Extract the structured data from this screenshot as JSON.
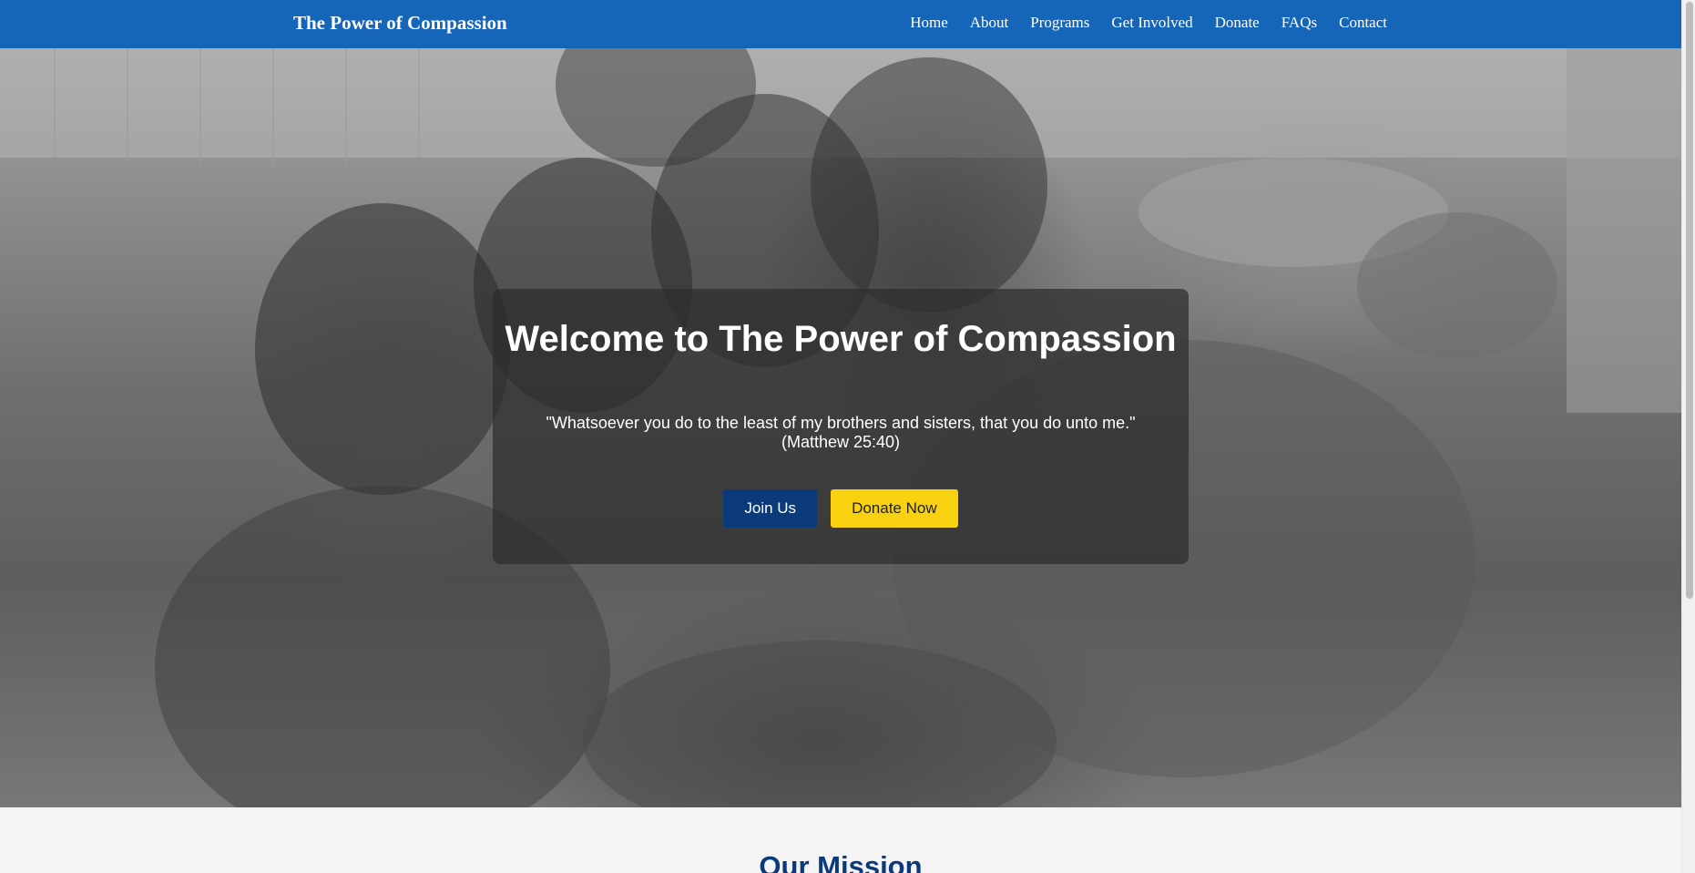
{
  "navbar": {
    "brand": "The Power of Compassion",
    "links": [
      "Home",
      "About",
      "Programs",
      "Get Involved",
      "Donate",
      "FAQs",
      "Contact"
    ]
  },
  "hero": {
    "title": "Welcome to The Power of Compassion",
    "quote": "\"Whatsoever you do to the least of my brothers and sisters, that you do unto me.\" (Matthew 25:40)",
    "join_label": "Join Us",
    "donate_label": "Donate Now"
  },
  "mission": {
    "title": "Our Mission"
  },
  "colors": {
    "nav_bg": "#1565b8",
    "join_bg": "#0b3a7a",
    "donate_bg": "#f8d211",
    "mission_title": "#0b3a7a"
  }
}
